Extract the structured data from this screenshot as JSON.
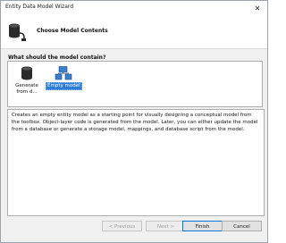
{
  "window": {
    "title": "Entity Data Model Wizard",
    "close_glyph": "✕"
  },
  "header": {
    "title": "Choose Model Contents"
  },
  "question": "What should the model contain?",
  "choices": [
    {
      "label": "Generate from d...",
      "icon": "database-icon",
      "selected": false
    },
    {
      "label": "Empty model",
      "icon": "empty-model-icon",
      "selected": true
    }
  ],
  "description": "Creates an empty entity model as a starting point for visually designing a conceptual model from the toolbox. Object-layer code is generated from the model. Later, you can either update the model from a database or generate a storage model, mappings, and database script from the model.",
  "buttons": {
    "previous": "< Previous",
    "next": "Next >",
    "finish": "Finish",
    "cancel": "Cancel"
  },
  "colors": {
    "selection": "#2f7bd7",
    "border": "#adadad",
    "window_bg": "#f0f0f0"
  }
}
